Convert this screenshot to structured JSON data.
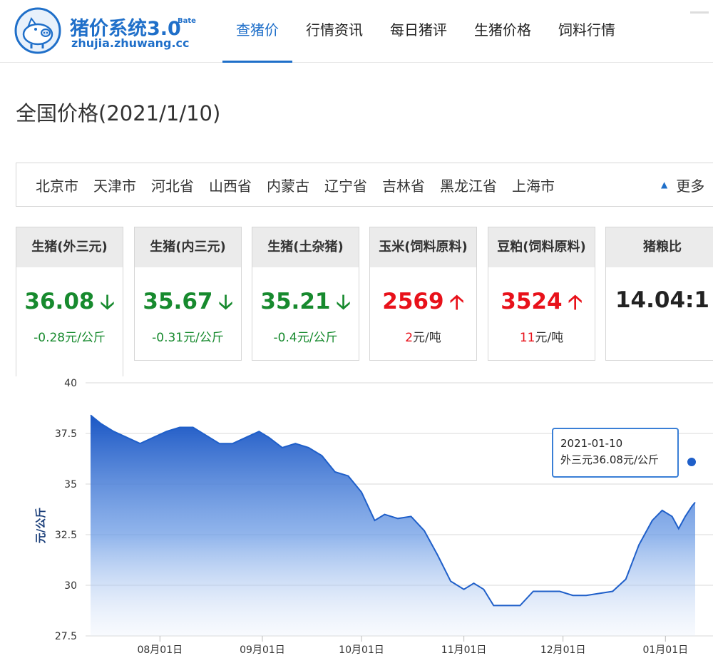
{
  "header": {
    "logo_title": "猪价系统3.0",
    "logo_badge": "Bate",
    "logo_url": "zhujia.zhuwang.cc",
    "nav": [
      {
        "label": "查猪价",
        "active": true
      },
      {
        "label": "行情资讯",
        "active": false
      },
      {
        "label": "每日猪评",
        "active": false
      },
      {
        "label": "生猪价格",
        "active": false
      },
      {
        "label": "饲料行情",
        "active": false
      }
    ]
  },
  "page_title": "全国价格(2021/1/10)",
  "provinces": [
    "北京市",
    "天津市",
    "河北省",
    "山西省",
    "内蒙古",
    "辽宁省",
    "吉林省",
    "黑龙江省",
    "上海市"
  ],
  "more_label": "更多",
  "cards": [
    {
      "title": "生猪(外三元)",
      "value": "36.08",
      "trend": "down",
      "change": "-0.28元/公斤",
      "color": "#178a2e"
    },
    {
      "title": "生猪(内三元)",
      "value": "35.67",
      "trend": "down",
      "change": "-0.31元/公斤",
      "color": "#178a2e"
    },
    {
      "title": "生猪(土杂猪)",
      "value": "35.21",
      "trend": "down",
      "change": "-0.4元/公斤",
      "color": "#178a2e"
    },
    {
      "title": "玉米(饲料原料)",
      "value": "2569",
      "trend": "up",
      "change_num": "2",
      "change_unit": "元/吨",
      "color": "#e8111a"
    },
    {
      "title": "豆粕(饲料原料)",
      "value": "3524",
      "trend": "up",
      "change_num": "11",
      "change_unit": "元/吨",
      "color": "#e8111a"
    },
    {
      "title": "猪粮比",
      "value": "14.04:1",
      "trend": "none",
      "change": "",
      "color": "#222222"
    }
  ],
  "chart_data": {
    "type": "area",
    "ylabel": "元/公斤",
    "ylim": [
      27.5,
      40
    ],
    "yticks": [
      27.5,
      30,
      32.5,
      35,
      37.5,
      40
    ],
    "xtick_labels": [
      "08月01日",
      "09月01日",
      "10月01日",
      "11月01日",
      "12月01日",
      "01月01日"
    ],
    "xtick_dates": [
      "2020-08-01",
      "2020-09-01",
      "2020-10-01",
      "2020-11-01",
      "2020-12-01",
      "2021-01-01"
    ],
    "x_range": [
      "2020-07-11",
      "2021-01-10"
    ],
    "grid": true,
    "series": [
      {
        "name": "外三元",
        "color": "#1f5fc9",
        "points": [
          [
            "2020-07-11",
            38.4
          ],
          [
            "2020-07-14",
            38.0
          ],
          [
            "2020-07-18",
            37.6
          ],
          [
            "2020-07-22",
            37.3
          ],
          [
            "2020-07-26",
            37.0
          ],
          [
            "2020-07-30",
            37.3
          ],
          [
            "2020-08-03",
            37.6
          ],
          [
            "2020-08-07",
            37.8
          ],
          [
            "2020-08-11",
            37.8
          ],
          [
            "2020-08-15",
            37.4
          ],
          [
            "2020-08-19",
            37.0
          ],
          [
            "2020-08-23",
            37.0
          ],
          [
            "2020-08-27",
            37.3
          ],
          [
            "2020-08-31",
            37.6
          ],
          [
            "2020-09-03",
            37.3
          ],
          [
            "2020-09-07",
            36.8
          ],
          [
            "2020-09-11",
            37.0
          ],
          [
            "2020-09-15",
            36.8
          ],
          [
            "2020-09-19",
            36.4
          ],
          [
            "2020-09-23",
            35.6
          ],
          [
            "2020-09-27",
            35.4
          ],
          [
            "2020-10-01",
            34.6
          ],
          [
            "2020-10-05",
            33.2
          ],
          [
            "2020-10-08",
            33.5
          ],
          [
            "2020-10-12",
            33.3
          ],
          [
            "2020-10-16",
            33.4
          ],
          [
            "2020-10-20",
            32.7
          ],
          [
            "2020-10-24",
            31.5
          ],
          [
            "2020-10-28",
            30.2
          ],
          [
            "2020-11-01",
            29.8
          ],
          [
            "2020-11-04",
            30.1
          ],
          [
            "2020-11-07",
            29.8
          ],
          [
            "2020-11-10",
            29.0
          ],
          [
            "2020-11-14",
            29.0
          ],
          [
            "2020-11-18",
            29.0
          ],
          [
            "2020-11-22",
            29.7
          ],
          [
            "2020-11-26",
            29.7
          ],
          [
            "2020-11-30",
            29.7
          ],
          [
            "2020-12-04",
            29.5
          ],
          [
            "2020-12-08",
            29.5
          ],
          [
            "2020-12-12",
            29.6
          ],
          [
            "2020-12-16",
            29.7
          ],
          [
            "2020-12-20",
            30.3
          ],
          [
            "2020-12-24",
            32.0
          ],
          [
            "2020-12-28",
            33.2
          ],
          [
            "2020-12-31",
            33.7
          ],
          [
            "2021-01-03",
            33.4
          ],
          [
            "2021-01-05",
            32.8
          ],
          [
            "2021-01-07",
            33.4
          ],
          [
            "2021-01-09",
            33.9
          ],
          [
            "2021-01-10",
            34.1
          ]
        ]
      }
    ],
    "tooltip": {
      "date": "2021-01-10",
      "label": "外三元36.08元/公斤"
    }
  }
}
